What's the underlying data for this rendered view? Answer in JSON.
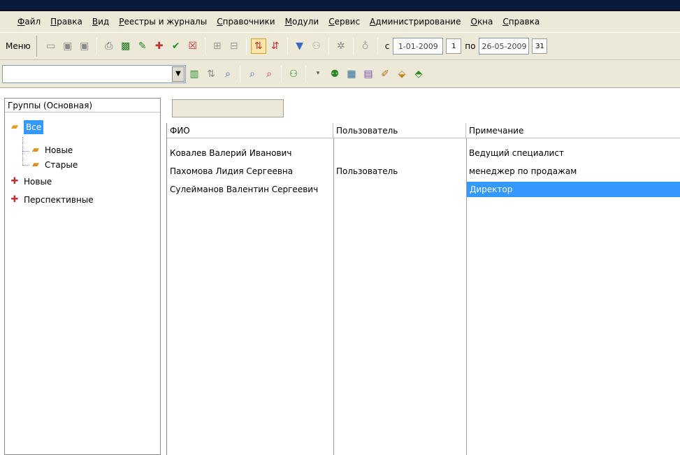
{
  "menu": [
    "Файл",
    "Правка",
    "Вид",
    "Реестры и журналы",
    "Справочники",
    "Модули",
    "Сервис",
    "Администрирование",
    "Окна",
    "Справка"
  ],
  "toolbar": {
    "menu_label": "Меню",
    "from_label": "с",
    "to_label": "по",
    "date_from": "1-01-2009",
    "date_to": "26-05-2009",
    "cal_from": "1",
    "cal_to": "31"
  },
  "groups": {
    "title": "Группы (Основная)",
    "tree": [
      {
        "label": "Все",
        "icon": "folder-open-icon",
        "level": 0,
        "selected": true
      },
      {
        "label": "Новые",
        "icon": "folder-new-icon",
        "level": 1,
        "selected": false
      },
      {
        "label": "Старые",
        "icon": "folder-new-icon",
        "level": 1,
        "selected": false
      },
      {
        "label": "Новые",
        "icon": "plus-box-icon",
        "level": 0,
        "selected": false
      },
      {
        "label": "Перспективные",
        "icon": "plus-box-icon",
        "level": 0,
        "selected": false
      }
    ]
  },
  "table": {
    "columns": [
      "ФИО",
      "Пользователь",
      "Примечание"
    ],
    "rows": [
      {
        "fio": "Ковалев Валерий Иванович",
        "user": "",
        "note": "Ведущий специалист",
        "selected": false
      },
      {
        "fio": "Пахомова Лидия Сергеевна",
        "user": "Пользователь",
        "note": "менеджер по продажам",
        "selected": false
      },
      {
        "fio": "Сулейманов Валентин Сергеевич",
        "user": "",
        "note": "Директор",
        "selected": true
      }
    ]
  },
  "colors": {
    "selection": "#3399ff",
    "chrome": "#ece9d8",
    "titlebar": "#0b1a3a"
  }
}
